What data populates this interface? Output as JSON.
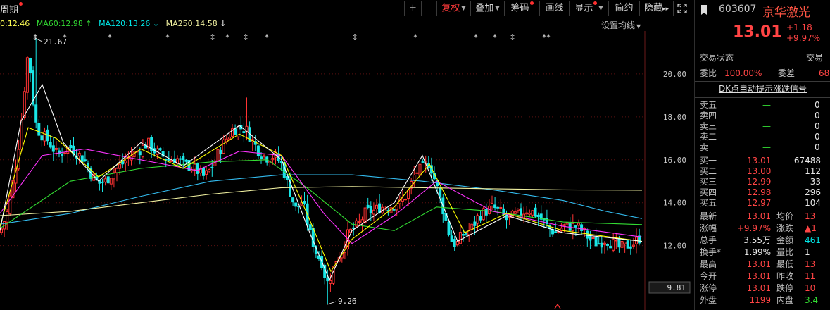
{
  "toolbar": {
    "period_label": "周期",
    "plus": "+",
    "minus": "—",
    "restore_right": "复权",
    "overlay": "叠加",
    "chips": "筹码",
    "draw_line": "画线",
    "display": "显示",
    "simple": "简约",
    "hide": "隐藏",
    "expand_arrows": "▸▸"
  },
  "ma_legend": {
    "ma_cut": "0:12.46",
    "ma60": "MA60:12.98",
    "ma120": "MA120:13.26",
    "ma250": "MA250:14.58",
    "arrow_ma60": "↑",
    "arrow_ma120": "↓",
    "arrow_ma250": "↓",
    "set_ma": "设置均线"
  },
  "price_axis": [
    "20.00",
    "18.00",
    "16.00",
    "14.00",
    "12.00"
  ],
  "price_box": "9.81",
  "annotations": {
    "high": "21.67",
    "low": "9.26"
  },
  "colors": {
    "up": "#ff3333",
    "down": "#19e6e6",
    "ma5": "#ffffff",
    "ma10": "#ffff00",
    "ma20": "#ff33ff",
    "ma30": "#33dd33",
    "ma60": "#ff9999",
    "ma120": "#33bbee",
    "ma250": "#f0f0a0"
  },
  "quote": {
    "code": "603607",
    "name": "京华激光",
    "price": "13.01",
    "change": "+1.18",
    "change_pct": "+9.97%",
    "trade_status_label": "交易状态",
    "trade_status_value": "交易",
    "weibi_label": "委比",
    "weibi_value": "100.00%",
    "weicha_label": "委差",
    "weicha_value": "68",
    "dk_label": "DK点自动提示涨跌信号",
    "asks": [
      {
        "label": "卖五",
        "price": "—",
        "vol": "0"
      },
      {
        "label": "卖四",
        "price": "—",
        "vol": "0"
      },
      {
        "label": "卖三",
        "price": "—",
        "vol": "0"
      },
      {
        "label": "卖二",
        "price": "—",
        "vol": "0"
      },
      {
        "label": "卖一",
        "price": "—",
        "vol": "0"
      }
    ],
    "bids": [
      {
        "label": "买一",
        "price": "13.01",
        "vol": "67488"
      },
      {
        "label": "买二",
        "price": "13.00",
        "vol": "112"
      },
      {
        "label": "买三",
        "price": "12.99",
        "vol": "33"
      },
      {
        "label": "买四",
        "price": "12.98",
        "vol": "296"
      },
      {
        "label": "买五",
        "price": "12.97",
        "vol": "104"
      }
    ],
    "stats": [
      {
        "l1": "最新",
        "v1": "13.01",
        "l2": "均价",
        "v2": "13"
      },
      {
        "l1": "涨幅",
        "v1": "+9.97%",
        "l2": "涨跌",
        "v2": "▲1"
      },
      {
        "l1": "总手",
        "v1": "3.55万",
        "l2": "金额",
        "v2": "461"
      },
      {
        "l1": "换手*",
        "v1": "1.99%",
        "l2": "量比",
        "v2": "1"
      },
      {
        "l1": "最高",
        "v1": "13.01",
        "l2": "最低",
        "v2": "13"
      },
      {
        "l1": "今开",
        "v1": "13.01",
        "l2": "昨收",
        "v2": "11"
      },
      {
        "l1": "涨停",
        "v1": "13.01",
        "l2": "跌停",
        "v2": "10"
      },
      {
        "l1": "外盘",
        "v1": "1199",
        "l2": "内盘",
        "v2": "3.4"
      }
    ]
  },
  "chart_data": {
    "type": "candlestick",
    "y_range": [
      9.0,
      22.0
    ],
    "y_ticks": [
      20,
      18,
      16,
      14,
      12
    ],
    "markers": [
      "⇟",
      "*",
      "*",
      "*",
      "↕",
      "*",
      "↕",
      "*",
      "↕",
      "*",
      "*",
      "*",
      "↕",
      "**"
    ],
    "anchors": [
      [
        0,
        12.6
      ],
      [
        10,
        13.5
      ],
      [
        20,
        15.2
      ],
      [
        28,
        17.0
      ],
      [
        34,
        19.0
      ],
      [
        38,
        20.8
      ],
      [
        42,
        20.5
      ],
      [
        46,
        19.0
      ],
      [
        52,
        17.5
      ],
      [
        58,
        17.2
      ],
      [
        66,
        17.0
      ],
      [
        74,
        16.6
      ],
      [
        82,
        16.2
      ],
      [
        90,
        16.4
      ],
      [
        100,
        16.6
      ],
      [
        110,
        16.3
      ],
      [
        120,
        16.0
      ],
      [
        130,
        15.3
      ],
      [
        140,
        14.9
      ],
      [
        150,
        15.0
      ],
      [
        160,
        15.4
      ],
      [
        170,
        15.7
      ],
      [
        180,
        16.0
      ],
      [
        190,
        16.3
      ],
      [
        200,
        16.5
      ],
      [
        210,
        16.8
      ],
      [
        220,
        16.4
      ],
      [
        230,
        16.2
      ],
      [
        240,
        16.0
      ],
      [
        250,
        16.1
      ],
      [
        260,
        15.8
      ],
      [
        270,
        15.7
      ],
      [
        280,
        15.5
      ],
      [
        290,
        15.2
      ],
      [
        300,
        15.6
      ],
      [
        310,
        16.3
      ],
      [
        320,
        16.9
      ],
      [
        330,
        17.4
      ],
      [
        340,
        17.5
      ],
      [
        350,
        17.4
      ],
      [
        360,
        16.8
      ],
      [
        370,
        16.3
      ],
      [
        380,
        16.1
      ],
      [
        390,
        16.2
      ],
      [
        400,
        15.8
      ],
      [
        410,
        14.7
      ],
      [
        420,
        13.7
      ],
      [
        430,
        14.1
      ],
      [
        440,
        12.6
      ],
      [
        450,
        11.6
      ],
      [
        458,
        11.2
      ],
      [
        464,
        10.2
      ],
      [
        470,
        10.6
      ],
      [
        478,
        11.4
      ],
      [
        486,
        11.8
      ],
      [
        494,
        12.5
      ],
      [
        502,
        12.8
      ],
      [
        510,
        13.0
      ],
      [
        520,
        13.6
      ],
      [
        530,
        13.6
      ],
      [
        540,
        13.8
      ],
      [
        550,
        13.8
      ],
      [
        560,
        13.9
      ],
      [
        570,
        14.0
      ],
      [
        580,
        14.5
      ],
      [
        590,
        15.4
      ],
      [
        600,
        15.6
      ],
      [
        610,
        15.9
      ],
      [
        620,
        14.8
      ],
      [
        630,
        13.6
      ],
      [
        640,
        12.3
      ],
      [
        648,
        12.0
      ],
      [
        656,
        12.5
      ],
      [
        664,
        12.6
      ],
      [
        672,
        12.9
      ],
      [
        680,
        13.4
      ],
      [
        690,
        13.6
      ],
      [
        700,
        13.8
      ],
      [
        710,
        13.6
      ],
      [
        720,
        13.2
      ],
      [
        730,
        13.4
      ],
      [
        740,
        13.5
      ],
      [
        750,
        13.7
      ],
      [
        760,
        13.5
      ],
      [
        770,
        13.2
      ],
      [
        780,
        12.8
      ],
      [
        790,
        12.6
      ],
      [
        800,
        12.9
      ],
      [
        810,
        12.9
      ],
      [
        820,
        12.9
      ],
      [
        830,
        12.6
      ],
      [
        840,
        12.2
      ],
      [
        850,
        12.1
      ],
      [
        860,
        12.3
      ],
      [
        870,
        12.1
      ],
      [
        880,
        11.9
      ],
      [
        890,
        12.0
      ],
      [
        900,
        12.1
      ],
      [
        910,
        12.4
      ]
    ],
    "spikes": [
      [
        50,
        21.67,
        "high"
      ],
      [
        465,
        9.26,
        "low"
      ],
      [
        598,
        17.3,
        "high"
      ],
      [
        350,
        18.9,
        "high"
      ]
    ],
    "ma_lines": [
      {
        "name": "MA120",
        "color": "#33bbee",
        "points": [
          [
            0,
            13.0
          ],
          [
            100,
            13.5
          ],
          [
            200,
            14.3
          ],
          [
            300,
            15.0
          ],
          [
            400,
            15.3
          ],
          [
            500,
            15.3
          ],
          [
            600,
            15.0
          ],
          [
            700,
            14.6
          ],
          [
            800,
            14.1
          ],
          [
            860,
            13.6
          ],
          [
            912,
            13.26
          ]
        ]
      },
      {
        "name": "MA250",
        "color": "#f0f0a0",
        "points": [
          [
            0,
            13.4
          ],
          [
            100,
            13.6
          ],
          [
            200,
            14.0
          ],
          [
            300,
            14.4
          ],
          [
            400,
            14.7
          ],
          [
            500,
            14.75
          ],
          [
            600,
            14.7
          ],
          [
            700,
            14.65
          ],
          [
            800,
            14.6
          ],
          [
            912,
            14.58
          ]
        ]
      },
      {
        "name": "MA60",
        "color": "#33dd33",
        "points": [
          [
            0,
            12.8
          ],
          [
            100,
            15.0
          ],
          [
            200,
            15.6
          ],
          [
            300,
            15.9
          ],
          [
            380,
            16.0
          ],
          [
            440,
            14.6
          ],
          [
            500,
            13.0
          ],
          [
            560,
            12.7
          ],
          [
            620,
            13.8
          ],
          [
            700,
            13.6
          ],
          [
            800,
            13.1
          ],
          [
            912,
            12.98
          ]
        ]
      },
      {
        "name": "MA30",
        "color": "#ff33ff",
        "points": [
          [
            0,
            13.5
          ],
          [
            60,
            16.2
          ],
          [
            120,
            16.5
          ],
          [
            200,
            16.0
          ],
          [
            280,
            15.5
          ],
          [
            340,
            16.4
          ],
          [
            400,
            16.2
          ],
          [
            460,
            13.5
          ],
          [
            500,
            12.1
          ],
          [
            560,
            13.4
          ],
          [
            620,
            15.0
          ],
          [
            700,
            13.6
          ],
          [
            800,
            12.9
          ],
          [
            912,
            12.4
          ]
        ]
      },
      {
        "name": "MA10",
        "color": "#ffff00",
        "points": [
          [
            0,
            12.9
          ],
          [
            40,
            17.5
          ],
          [
            80,
            17.0
          ],
          [
            140,
            15.2
          ],
          [
            200,
            16.5
          ],
          [
            260,
            15.6
          ],
          [
            340,
            17.2
          ],
          [
            400,
            16.2
          ],
          [
            440,
            13.2
          ],
          [
            470,
            10.8
          ],
          [
            500,
            12.3
          ],
          [
            560,
            13.8
          ],
          [
            610,
            15.8
          ],
          [
            660,
            12.6
          ],
          [
            720,
            13.5
          ],
          [
            800,
            12.7
          ],
          [
            912,
            12.2
          ]
        ]
      },
      {
        "name": "MA5",
        "color": "#ffffff",
        "points": [
          [
            0,
            12.7
          ],
          [
            30,
            17.8
          ],
          [
            60,
            19.5
          ],
          [
            90,
            16.8
          ],
          [
            140,
            15.0
          ],
          [
            200,
            16.8
          ],
          [
            260,
            15.7
          ],
          [
            340,
            17.6
          ],
          [
            400,
            16.0
          ],
          [
            440,
            12.6
          ],
          [
            468,
            10.4
          ],
          [
            500,
            12.7
          ],
          [
            560,
            14.0
          ],
          [
            600,
            16.2
          ],
          [
            650,
            12.2
          ],
          [
            720,
            13.4
          ],
          [
            800,
            12.6
          ],
          [
            912,
            12.2
          ]
        ]
      }
    ]
  }
}
